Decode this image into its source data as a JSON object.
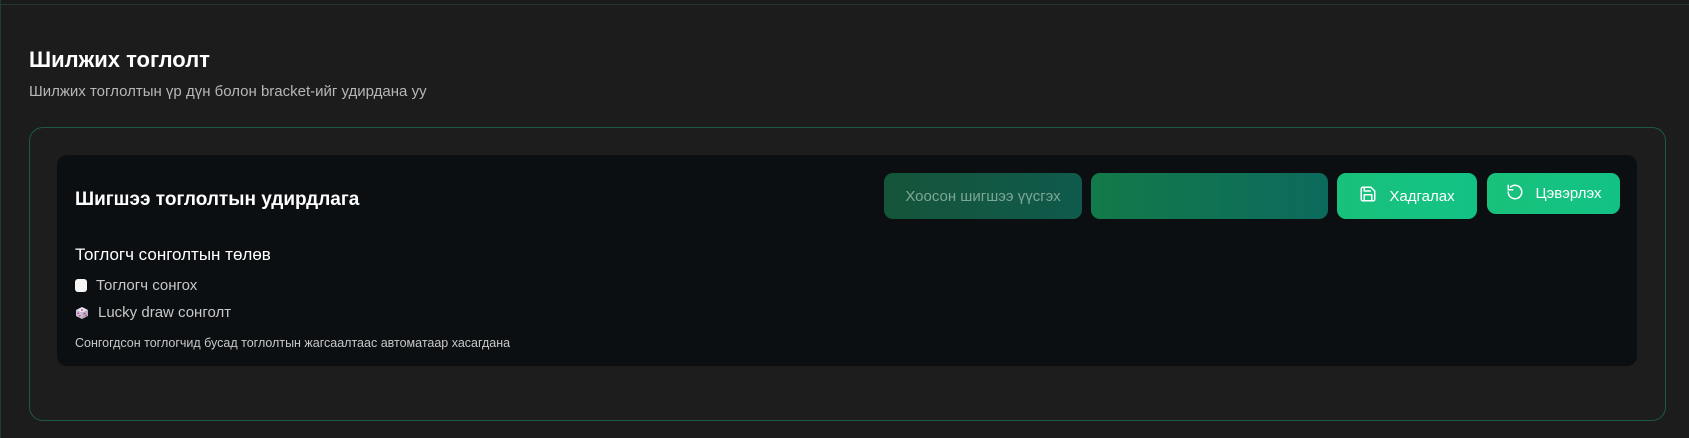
{
  "header": {
    "title": "Шилжих тоглолт",
    "subtitle": "Шилжих тоглолтын үр дүн болон bracket-ийг удирдана уу"
  },
  "panel": {
    "title": "Шигшээ тоглолтын удирдлага",
    "buttons": {
      "empty_slots": "Хоосон шигшээ үүсгэх",
      "blank": "",
      "save": "Хадгалах",
      "reset": "Цэвэрлэх"
    },
    "status_title": "Тоглогч сонголтын төлөв",
    "legend": [
      {
        "label": "Тоглогч сонгох",
        "icon": "white-square-icon"
      },
      {
        "label": "Lucky draw сонголт",
        "icon": "dice-icon"
      }
    ],
    "note": "Сонгогдсон тоглогчид бусад тоглолтын жагсаалтаас автоматаар хасагдана"
  },
  "colors": {
    "accent": "#19c17a",
    "background": "#1c1c1c",
    "panel": "#0b0f12",
    "border": "#1f5a40"
  }
}
